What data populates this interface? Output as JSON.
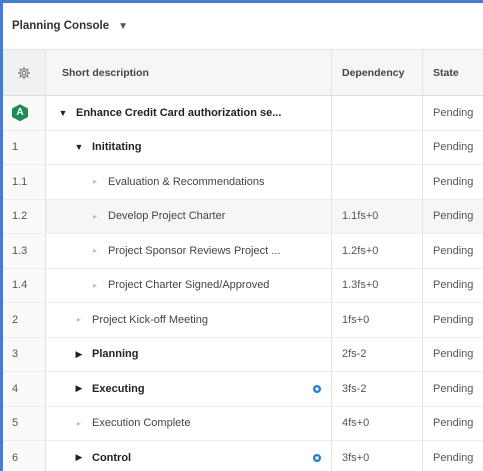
{
  "header": {
    "title": "Planning Console",
    "caret": "▼"
  },
  "columns": {
    "desc": "Short description",
    "dep": "Dependency",
    "state": "State"
  },
  "rows": [
    {
      "num": "",
      "badge": "A",
      "indent": 0,
      "twisty": "expanded",
      "desc": "Enhance Credit Card authorization se...",
      "bold": true,
      "dep": "",
      "state": "Pending",
      "dot": false
    },
    {
      "num": "1",
      "indent": 1,
      "twisty": "expanded",
      "desc": "Inititating",
      "bold": true,
      "dep": "",
      "state": "Pending",
      "dot": false
    },
    {
      "num": "1.1",
      "indent": 2,
      "twisty": "leaf",
      "desc": "Evaluation & Recommendations",
      "bold": false,
      "dep": "",
      "state": "Pending",
      "dot": false
    },
    {
      "num": "1.2",
      "indent": 2,
      "twisty": "leaf",
      "desc": "Develop Project Charter",
      "bold": false,
      "dep": "1.1fs+0",
      "state": "Pending",
      "dot": false,
      "highlight": true
    },
    {
      "num": "1.3",
      "indent": 2,
      "twisty": "leaf",
      "desc": "Project Sponsor Reviews Project ...",
      "bold": false,
      "dep": "1.2fs+0",
      "state": "Pending",
      "dot": false
    },
    {
      "num": "1.4",
      "indent": 2,
      "twisty": "leaf",
      "desc": "Project Charter Signed/Approved",
      "bold": false,
      "dep": "1.3fs+0",
      "state": "Pending",
      "dot": false
    },
    {
      "num": "2",
      "indent": 1,
      "twisty": "leaf",
      "desc": "Project Kick-off Meeting",
      "bold": false,
      "dep": "1fs+0",
      "state": "Pending",
      "dot": false
    },
    {
      "num": "3",
      "indent": 1,
      "twisty": "collapsed",
      "desc": "Planning",
      "bold": true,
      "dep": "2fs-2",
      "state": "Pending",
      "dot": false
    },
    {
      "num": "4",
      "indent": 1,
      "twisty": "collapsed",
      "desc": "Executing",
      "bold": true,
      "dep": "3fs-2",
      "state": "Pending",
      "dot": true
    },
    {
      "num": "5",
      "indent": 1,
      "twisty": "leaf",
      "desc": "Execution Complete",
      "bold": false,
      "dep": "4fs+0",
      "state": "Pending",
      "dot": false
    },
    {
      "num": "6",
      "indent": 1,
      "twisty": "collapsed",
      "desc": "Control",
      "bold": true,
      "dep": "3fs+0",
      "state": "Pending",
      "dot": true
    }
  ],
  "colors": {
    "frame": "#4a7bd1",
    "badge": "#1e8b5a",
    "dot": "#1f7ad1"
  },
  "icons": {
    "settings": "gear-icon",
    "expanded": "triangle-down-icon",
    "collapsed": "triangle-right-icon",
    "leaf": "leaf-triangle-icon"
  }
}
